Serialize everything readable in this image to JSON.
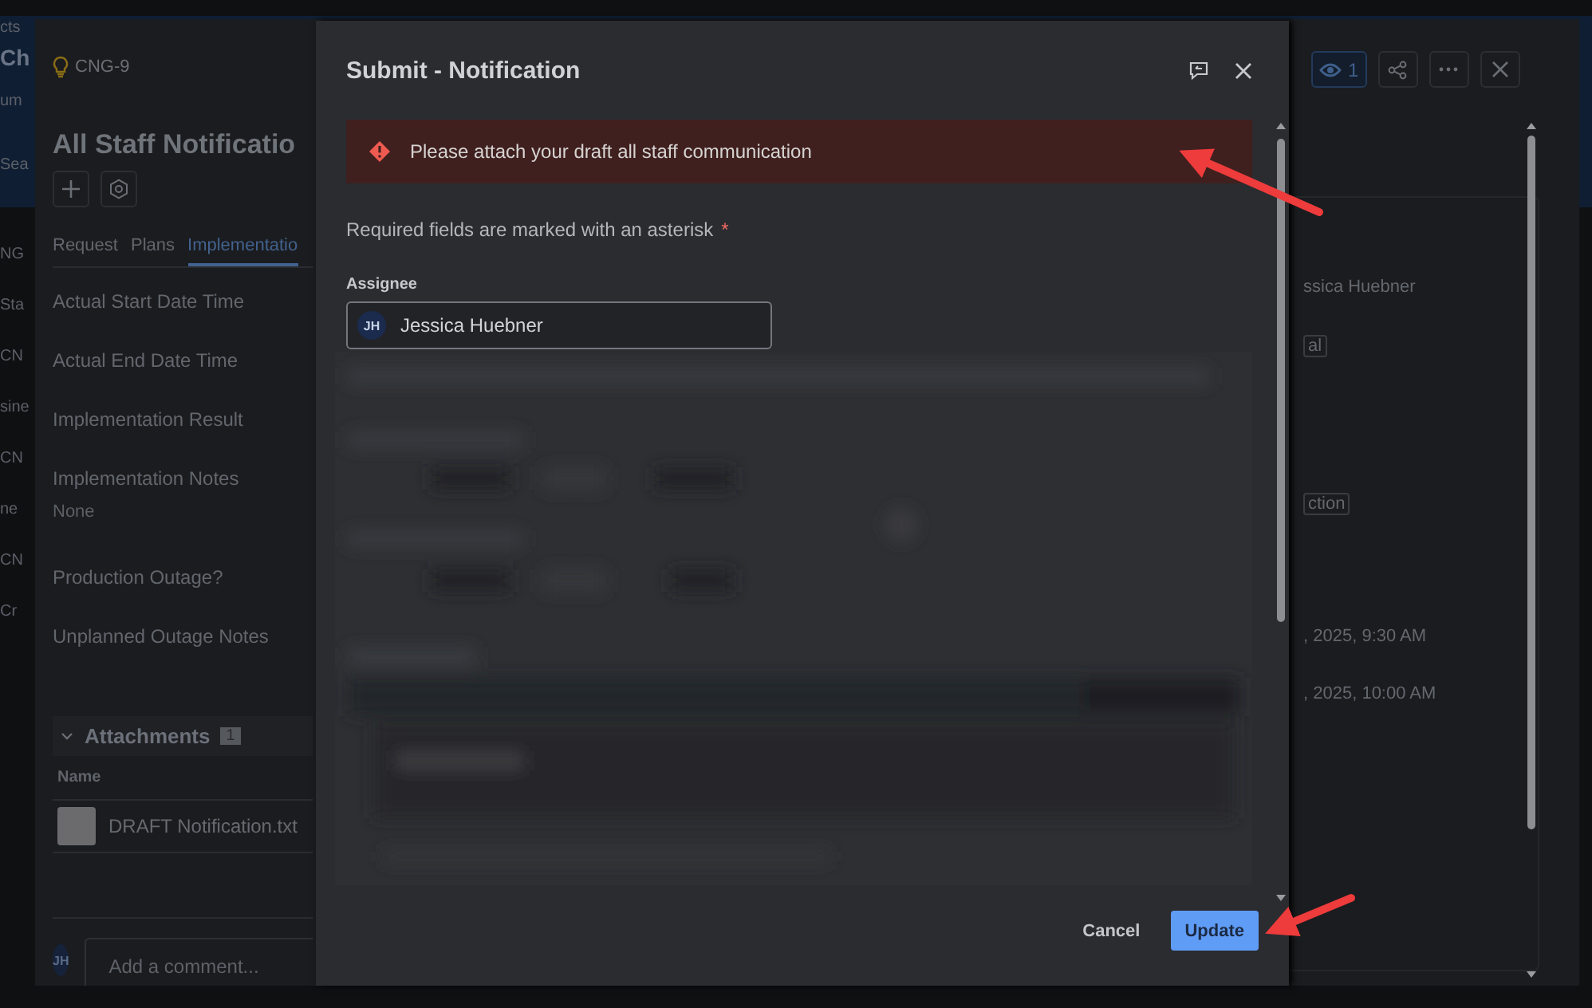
{
  "side_fragments": {
    "top": [
      "cts",
      "Ch",
      "um",
      "Sea"
    ],
    "list": [
      "NG",
      "Sta",
      "CN",
      "sine",
      "CN",
      "ne",
      "CN",
      "Cr"
    ]
  },
  "record": {
    "key": "CNG-9",
    "title": "All Staff Notificatio",
    "tabs": [
      {
        "label": "Request",
        "selected": false
      },
      {
        "label": "Plans",
        "selected": false
      },
      {
        "label": "Implementatio",
        "selected": true
      }
    ],
    "fields": [
      {
        "label": "Actual Start Date Time"
      },
      {
        "label": "Actual End Date Time"
      },
      {
        "label": "Implementation Result"
      },
      {
        "label": "Implementation Notes",
        "value": "None"
      },
      {
        "label": "Production Outage?"
      },
      {
        "label": "Unplanned Outage Notes"
      }
    ],
    "attachments": {
      "title": "Attachments",
      "count": "1",
      "column": "Name",
      "files": [
        "DRAFT Notification.txt"
      ]
    },
    "comment": {
      "avatar": "JH",
      "placeholder": "Add a comment..."
    }
  },
  "header": {
    "watchers": "1"
  },
  "details": [
    {
      "kind": "text",
      "text": "ssica Huebner"
    },
    {
      "kind": "tag",
      "text": "al"
    },
    {
      "kind": "tag",
      "text": "ction"
    },
    {
      "kind": "text",
      "text": ", 2025, 9:30 AM"
    },
    {
      "kind": "text",
      "text": ", 2025, 10:00 AM"
    }
  ],
  "dialog": {
    "title": "Submit - Notification",
    "error": "Please attach your draft all staff communication",
    "required_note": "Required fields are marked with an asterisk",
    "asterisk": "*",
    "assignee_label": "Assignee",
    "assignee": {
      "avatar": "JH",
      "name": "Jessica Huebner"
    },
    "buttons": {
      "cancel": "Cancel",
      "update": "Update"
    }
  }
}
